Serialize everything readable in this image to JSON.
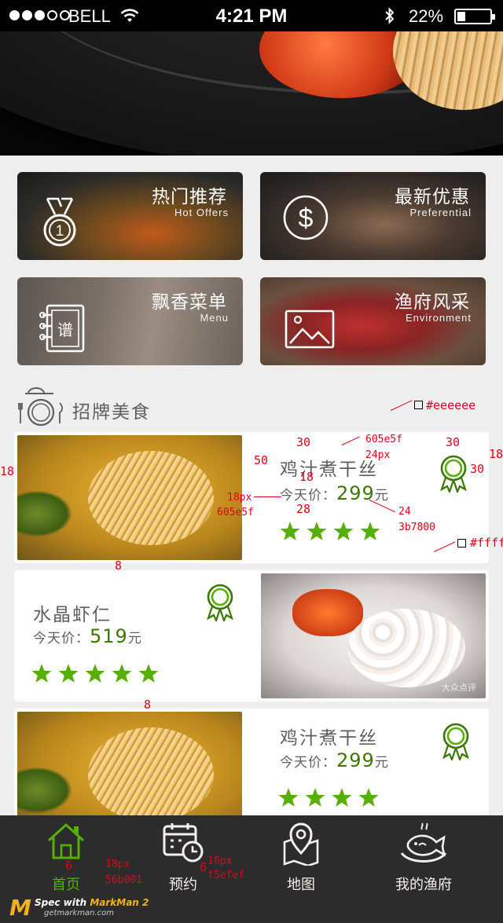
{
  "status_bar": {
    "carrier": "BELL",
    "time": "4:21 PM",
    "battery": "22%",
    "signal_icon": "signal-dots-icon",
    "wifi_icon": "wifi-icon",
    "bluetooth_icon": "bluetooth-icon"
  },
  "tiles": [
    {
      "title": "热门推荐",
      "subtitle": "Hot Offers",
      "icon": "medal-icon"
    },
    {
      "title": "最新优惠",
      "subtitle": "Preferential",
      "icon": "dollar-icon"
    },
    {
      "title": "飘香菜单",
      "subtitle": "Menu",
      "icon": "menu-book-icon",
      "icon_text": "谱"
    },
    {
      "title": "渔府风采",
      "subtitle": "Environment",
      "icon": "picture-icon"
    }
  ],
  "section": {
    "title": "招牌美食",
    "icon": "dinner-plate-icon"
  },
  "dishes": [
    {
      "name": "鸡汁煮干丝",
      "price_label": "今天价：",
      "price": "299",
      "unit": "元",
      "stars": 4,
      "badge": "ribbon-badge-icon"
    },
    {
      "name": "水晶虾仁",
      "price_label": "今天价：",
      "price": "519",
      "unit": "元",
      "stars": 5,
      "badge": "ribbon-badge-icon",
      "photo_watermark": "大众点评"
    },
    {
      "name": "鸡汁煮干丝",
      "price_label": "今天价：",
      "price": "299",
      "unit": "元",
      "stars": 4,
      "badge": "ribbon-badge-icon"
    }
  ],
  "tabbar": [
    {
      "label": "首页",
      "icon": "home-icon",
      "active": true
    },
    {
      "label": "预约",
      "icon": "calendar-clock-icon",
      "active": false
    },
    {
      "label": "地图",
      "icon": "map-pin-icon",
      "active": false
    },
    {
      "label": "我的渔府",
      "icon": "fish-dish-icon",
      "active": false
    }
  ],
  "colors": {
    "background": "#eeeeee",
    "card": "#ffffff",
    "text": "#605e5f",
    "price": "#3b7800",
    "star": "#56b001",
    "tab_active": "#56b001",
    "tab_inactive": "#f5efef",
    "tabbar_bg": "#2d2c2d",
    "annotation": "#e0001b"
  },
  "annotations": {
    "bg_color": "#eeeeee",
    "card_color": "#fffff",
    "pad_top": "30",
    "text_color": "605e5f",
    "title_size": "24px",
    "badge_top": "30",
    "edge_right": "18",
    "badge_right": "30",
    "gap_50": "50",
    "edge_left": "18",
    "gap_18": "18",
    "label_size": "18px",
    "label_color": "605e5f",
    "gap_28": "28",
    "price_size": "24",
    "price_color": "3b7800",
    "card_gap_1": "8",
    "card_gap_2": "8",
    "tab_icon_gap_1": "6",
    "tab_size_1": "18px",
    "tab_color_1": "56b001",
    "tab_icon_gap_2": "6",
    "tab_size_2": "18px",
    "tab_color_2": "f5efef"
  },
  "markman": {
    "line1_a": "Spec with",
    "line1_b": "MarkMan 2",
    "url": "getmarkman.com",
    "logo": "M"
  }
}
